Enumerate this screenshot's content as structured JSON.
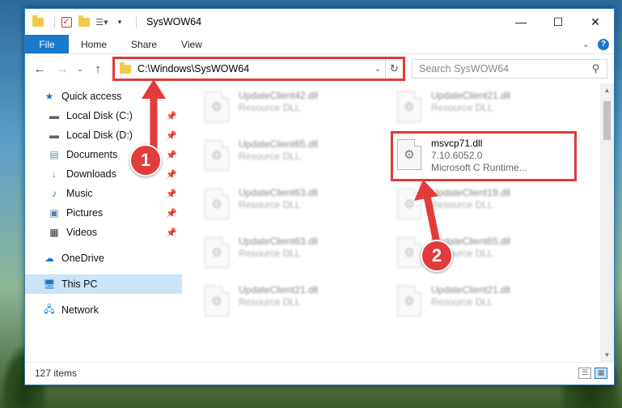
{
  "window": {
    "title": "SysWOW64",
    "controls": [
      "—",
      "☐",
      "✕"
    ]
  },
  "ribbon": {
    "tabs": [
      "File",
      "Home",
      "Share",
      "View"
    ],
    "expand_icon": "chevron-down-icon",
    "help": "?"
  },
  "address": {
    "path": "C:\\Windows\\SysWOW64",
    "search_placeholder": "Search SysWOW64"
  },
  "sidebar": {
    "items": [
      {
        "label": "Quick access",
        "icon": "star-icon",
        "pinned": false
      },
      {
        "label": "Local Disk (C:)",
        "icon": "drive-icon",
        "pinned": true
      },
      {
        "label": "Local Disk (D:)",
        "icon": "drive-icon",
        "pinned": true
      },
      {
        "label": "Documents",
        "icon": "documents-icon",
        "pinned": true
      },
      {
        "label": "Downloads",
        "icon": "download-icon",
        "pinned": true
      },
      {
        "label": "Music",
        "icon": "music-icon",
        "pinned": true
      },
      {
        "label": "Pictures",
        "icon": "pictures-icon",
        "pinned": true
      },
      {
        "label": "Videos",
        "icon": "videos-icon",
        "pinned": true
      },
      {
        "label": "OneDrive",
        "icon": "cloud-icon",
        "pinned": false
      },
      {
        "label": "This PC",
        "icon": "computer-icon",
        "pinned": false,
        "selected": true
      },
      {
        "label": "Network",
        "icon": "network-icon",
        "pinned": false
      }
    ]
  },
  "files": {
    "left": [
      {
        "name": "UpdateClient42.dll",
        "sub": "Resource DLL"
      },
      {
        "name": "UpdateClient65.dll",
        "sub": "Resource DLL"
      },
      {
        "name": "UpdateClient63.dll",
        "sub": "Resource DLL"
      },
      {
        "name": "UpdateClient63.dll",
        "sub": "Resource DLL"
      },
      {
        "name": "UpdateClient21.dll",
        "sub": "Resource DLL"
      }
    ],
    "right": [
      {
        "name": "UpdateClient21.dll",
        "sub": "Resource DLL"
      },
      {
        "name": "msvcp71.dll",
        "sub": "7.10.6052.0",
        "sub2": "Microsoft C Runtime...",
        "highlighted": true
      },
      {
        "name": "UpdateClient19.dll",
        "sub": "Resource DLL"
      },
      {
        "name": "UpdateClient65.dll",
        "sub": "Resource DLL"
      },
      {
        "name": "UpdateClient21.dll",
        "sub": "Resource DLL"
      }
    ]
  },
  "status": {
    "item_count": "127 items"
  },
  "annotations": {
    "badge1": "1",
    "badge2": "2",
    "color": "#e23b3b"
  }
}
